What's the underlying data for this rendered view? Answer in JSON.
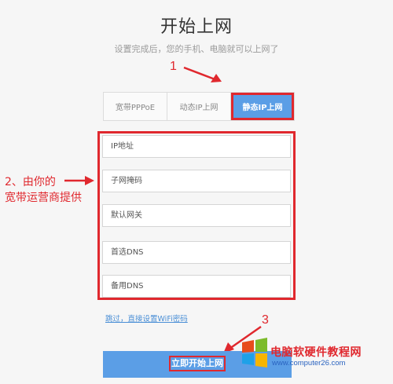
{
  "header": {
    "title": "开始上网",
    "subtitle": "设置完成后，您的手机、电脑就可以上网了"
  },
  "tabs": [
    {
      "label": "宽带PPPoE",
      "active": false
    },
    {
      "label": "动态IP上网",
      "active": false
    },
    {
      "label": "静态IP上网",
      "active": true
    }
  ],
  "fields": [
    {
      "placeholder": "IP地址",
      "value": ""
    },
    {
      "placeholder": "子网掩码",
      "value": ""
    },
    {
      "placeholder": "默认网关",
      "value": ""
    },
    {
      "placeholder": "首选DNS",
      "value": ""
    },
    {
      "placeholder": "备用DNS",
      "value": ""
    }
  ],
  "annotations": {
    "step1": "1",
    "step2_line1": "2、由你的",
    "step2_line2": "宽带运营商提供",
    "step3": "3"
  },
  "skip_link": "跳过，直接设置WiFi密码",
  "start_button": "立即开始上网",
  "watermark": {
    "text": "电脑软硬件教程网",
    "url": "www.computer26.com"
  },
  "colors": {
    "accent": "#5b9ee6",
    "annotation": "#e0282e",
    "background": "#f6f6f6"
  }
}
